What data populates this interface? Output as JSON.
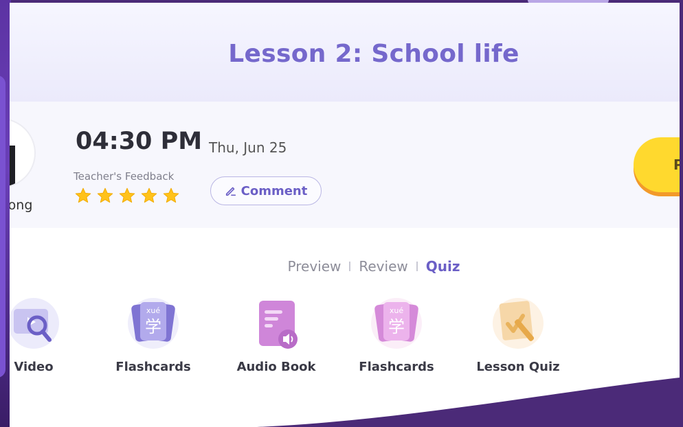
{
  "lesson": {
    "title": "Lesson 2: School life"
  },
  "session": {
    "teacher_name": "Wong",
    "time": "04:30 PM",
    "date": "Thu, Jun 25",
    "feedback_label": "Teacher's Feedback",
    "rating": 5,
    "comment_label": "Comment",
    "primary_button_label": "P"
  },
  "tabs": [
    "Preview",
    "Review",
    "Quiz"
  ],
  "active_tab": "Quiz",
  "activities": [
    {
      "label": "Video",
      "icon": "video-search-icon"
    },
    {
      "label": "Flashcards",
      "icon": "flashcards-icon",
      "pinyin": "xué",
      "hanzi": "学"
    },
    {
      "label": "Audio Book",
      "icon": "audio-book-icon"
    },
    {
      "label": "Flashcards",
      "icon": "flashcards-icon",
      "pinyin": "xué",
      "hanzi": "学"
    },
    {
      "label": "Lesson Quiz",
      "icon": "lesson-quiz-icon"
    }
  ],
  "colors": {
    "accent": "#7568cc",
    "background": "#4b2a78",
    "star": "#ffc21a",
    "button": "#ffd92e"
  }
}
